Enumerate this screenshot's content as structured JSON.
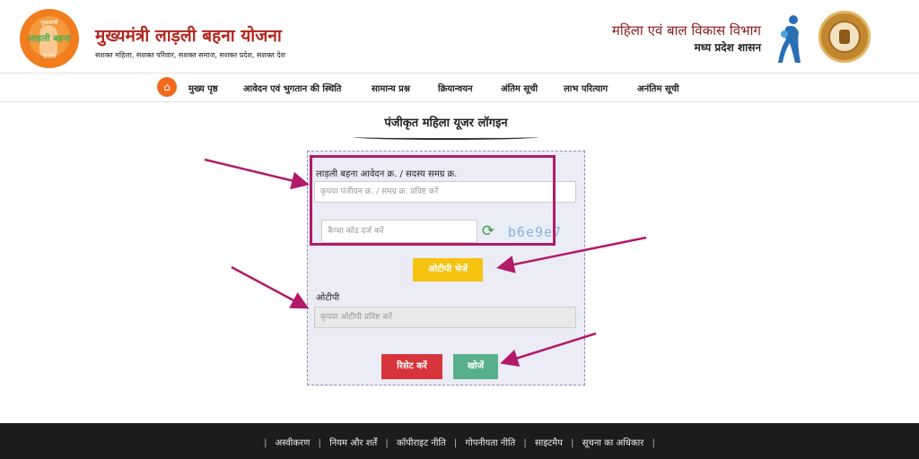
{
  "header": {
    "logo": {
      "line1": "मुख्यमंत्री",
      "line2": "लाड़ली बहना",
      "line3": "योजना"
    },
    "title": "मुख्यमंत्री लाड़ली बहना योजना",
    "tagline": "सशक्त महिला, सशक्त परिवार, सशक्त समाज, सशक्त प्रदेश, सशक्त देश",
    "department": "महिला एवं बाल विकास विभाग",
    "government": "मध्य प्रदेश शासन",
    "emblem_icon": "women-child-emblem-icon",
    "seal_icon": "mp-state-seal-icon"
  },
  "nav": {
    "home_icon": "home-icon",
    "items": [
      "मुख्य पृष्ठ",
      "आवेदन एवं भुगतान की स्थिति",
      "सामान्य प्रश्न",
      "क्रियान्वयन",
      "अंतिम सूची",
      "लाभ परित्याग",
      "अनंतिम सूची"
    ]
  },
  "login": {
    "heading": "पंजीकृत महिला यूजर लॉगइन",
    "app_label": "लाड़ली बहना आवेदन क्र. / सदस्य समग्र क्र.",
    "app_placeholder": "कृपया पंजीयन क्र. / समग्र क्र. प्रविष्ट करें",
    "captcha_placeholder": "कैप्चा कोड दर्ज करें",
    "captcha_code": "b6e9e7",
    "refresh_icon": "refresh-icon",
    "send_otp": "ओटीपी भेजें",
    "otp_label": "ओटीपी",
    "otp_placeholder": "कृपया ओटीपी प्रविष्ट करें",
    "reset": "रिसेट करें",
    "search": "खोजें"
  },
  "footer": {
    "links": [
      "अस्वीकरण",
      "नियम और शर्तें",
      "कॉपीराइट नीति",
      "गोपनीयता नीति",
      "साइटमैप",
      "सूचना का अधिकार"
    ]
  },
  "colors": {
    "accent_orange": "#f06b1e",
    "title_red": "#b3261e",
    "otp_button": "#f4c20f",
    "reset_button": "#d7343b",
    "search_button": "#58b08a",
    "annotation": "#b21a6a",
    "footer_bg": "#1c1c1c"
  }
}
